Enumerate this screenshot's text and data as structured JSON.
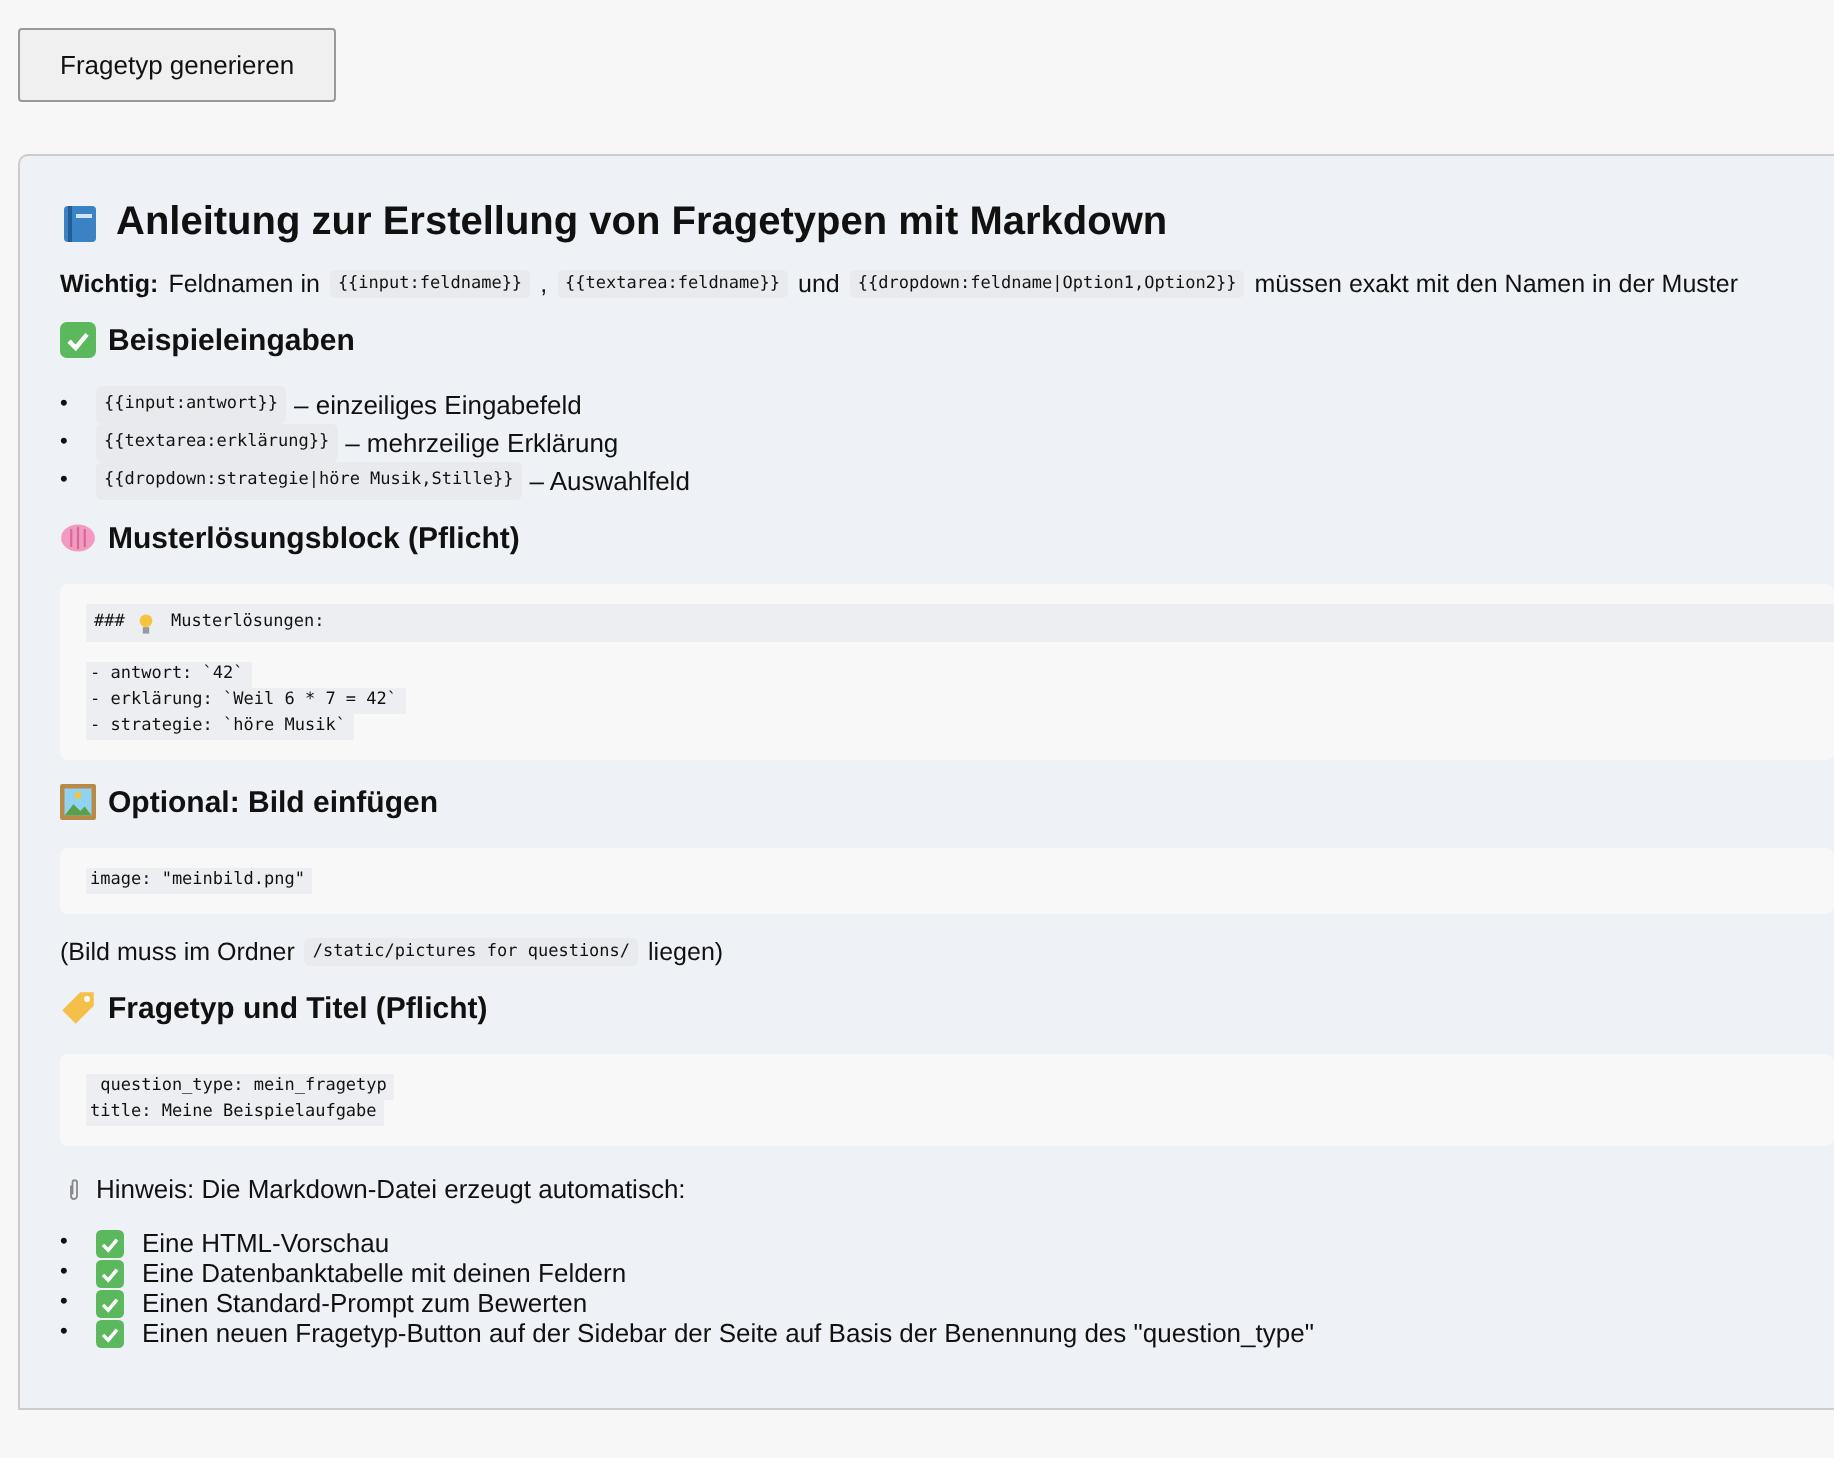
{
  "button": "Fragetyp generieren",
  "title": "Anleitung zur Erstellung von Fragetypen mit Markdown",
  "blocks": [
    {
      "kind": "paragraph",
      "parts": [
        {
          "kind": "strong",
          "text": "Wichtig:"
        },
        {
          "kind": "text",
          "text": "Feldnamen in"
        },
        {
          "kind": "code",
          "text": "{{input:feldname}}"
        },
        {
          "kind": "text",
          "text": ","
        },
        {
          "kind": "code",
          "text": "{{textarea:feldname}}"
        },
        {
          "kind": "text",
          "text": "und"
        },
        {
          "kind": "code",
          "text": "{{dropdown:feldname|Option1,Option2}}"
        },
        {
          "kind": "text",
          "text": "müssen exakt mit den Namen in der Muster"
        }
      ]
    },
    {
      "kind": "heading",
      "text": "Beispieleingaben"
    },
    {
      "kind": "list",
      "items": [
        {
          "marker": "•",
          "code": "{{input:antwort}}",
          "text": "– einzeiliges Eingabefeld"
        },
        {
          "marker": "•",
          "code": "{{textarea:erklärung}}",
          "text": "– mehrzeilige Erklärung"
        },
        {
          "marker": "•",
          "code": "{{dropdown:strategie|höre Musik,Stille}}",
          "text": "– Auswahlfeld"
        }
      ]
    },
    {
      "kind": "heading",
      "text": "Musterlösungsblock (Pflicht)"
    },
    {
      "kind": "codeblock",
      "groups": [
        [
          "### ",
          "Musterlösungen:"
        ],
        [
          "- antwort: `42`",
          "- erklärung: `Weil 6 * 7 = 42`",
          "- strategie: `höre Musik`"
        ]
      ]
    },
    {
      "kind": "heading",
      "text": "Optional: Bild einfügen"
    },
    {
      "kind": "codeblock",
      "groups": [
        [
          "image: \"meinbild.png\""
        ]
      ]
    },
    {
      "kind": "paragraph",
      "parts": [
        {
          "kind": "text",
          "text": "(Bild muss im Ordner"
        },
        {
          "kind": "code",
          "text": "/static/pictures for questions/"
        },
        {
          "kind": "text",
          "text": "liegen)"
        }
      ]
    },
    {
      "kind": "heading",
      "text": "Fragetyp und Titel (Pflicht)"
    },
    {
      "kind": "codeblock",
      "groups": [
        [
          " question_type: mein_fragetyp",
          "title: Meine Beispielaufgabe"
        ]
      ]
    },
    {
      "kind": "note",
      "text": "Hinweis: Die Markdown-Datei erzeugt automatisch:"
    },
    {
      "kind": "checklist",
      "items": [
        {
          "marker": "•",
          "text": "Eine HTML-Vorschau"
        },
        {
          "marker": "•",
          "text": "Eine Datenbanktabelle mit deinen Feldern"
        },
        {
          "marker": "•",
          "text": "Einen Standard-Prompt zum Bewerten"
        },
        {
          "marker": "•",
          "text": "Einen neuen Fragetyp-Button auf der Sidebar der Seite auf Basis der Benennung des \"question_type\""
        }
      ]
    }
  ]
}
